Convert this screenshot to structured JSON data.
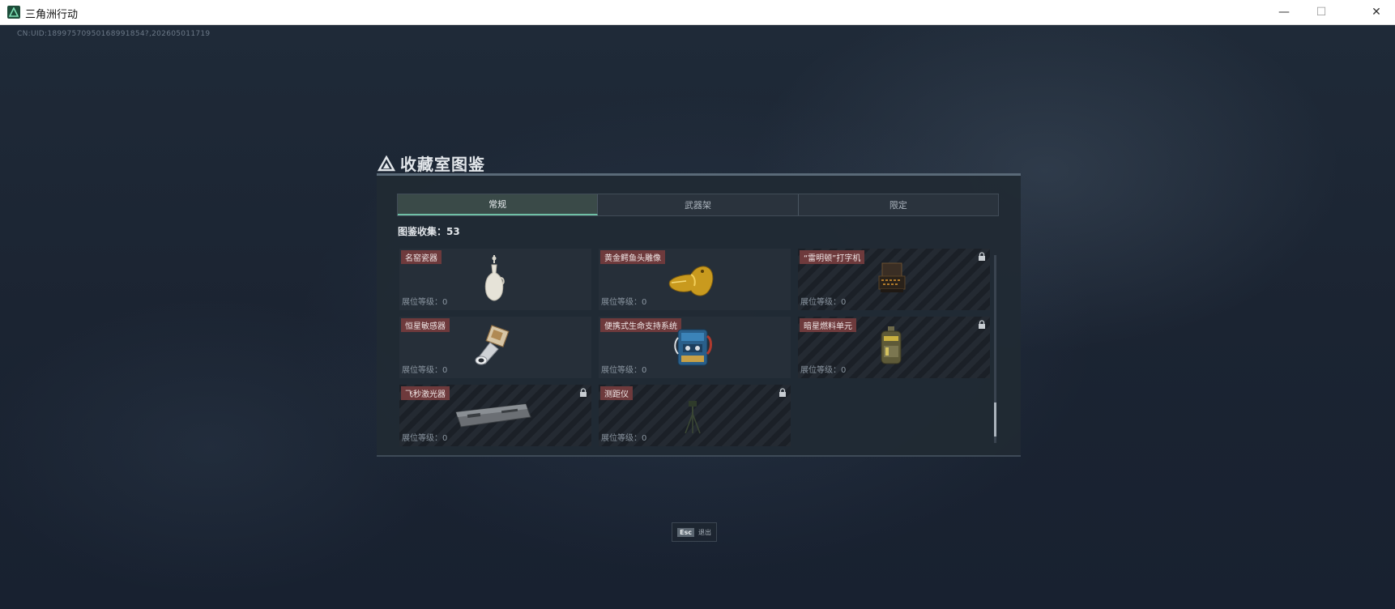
{
  "window": {
    "title": "三角洲行动",
    "minimize_symbol": "—",
    "maximize_symbol": "☐",
    "close_symbol": "✕"
  },
  "uid_text": "CN:UID:18997570950168991854?,202605011719",
  "panel": {
    "title": "收藏室图鉴",
    "tabs": [
      {
        "label": "常规",
        "active": true
      },
      {
        "label": "武器架",
        "active": false
      },
      {
        "label": "限定",
        "active": false
      }
    ],
    "collection_label": "图鉴收集：53",
    "items": [
      {
        "name": "名窑瓷器",
        "level": "展位等级：0",
        "locked": false,
        "icon": "porcelain-vase-icon"
      },
      {
        "name": "黄金鳄鱼头雕像",
        "level": "展位等级：0",
        "locked": false,
        "icon": "gold-crocodile-head-icon"
      },
      {
        "name": "“雷明顿”打字机",
        "level": "展位等级：0",
        "locked": true,
        "icon": "typewriter-icon"
      },
      {
        "name": "恒星敏感器",
        "level": "展位等级：0",
        "locked": false,
        "icon": "star-sensor-icon"
      },
      {
        "name": "便携式生命支持系统",
        "level": "展位等级：0",
        "locked": false,
        "icon": "life-support-system-icon"
      },
      {
        "name": "暗星燃料单元",
        "level": "展位等级：0",
        "locked": true,
        "icon": "fuel-cell-icon"
      },
      {
        "name": "飞秒激光器",
        "level": "展位等级：0",
        "locked": true,
        "icon": "femtosecond-laser-icon"
      },
      {
        "name": "测距仪",
        "level": "展位等级：0",
        "locked": true,
        "icon": "rangefinder-tripod-icon"
      }
    ]
  },
  "footer": {
    "esc_key": "Esc",
    "esc_label": "退出"
  },
  "colors": {
    "accent": "#6fbfa5",
    "name_tag": "#6e3a3c",
    "background": "#1a2433"
  }
}
